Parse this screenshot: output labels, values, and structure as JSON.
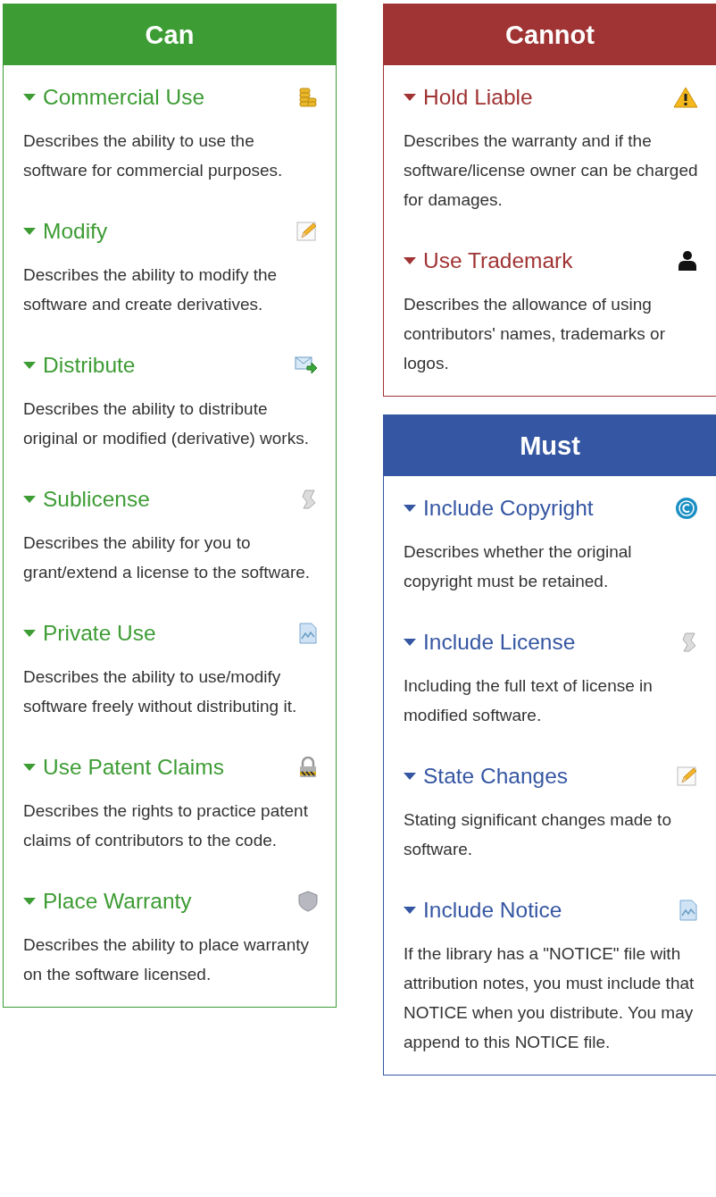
{
  "columns": [
    {
      "panels": [
        {
          "kind": "can",
          "title": "Can",
          "items": [
            {
              "title": "Commercial Use",
              "expanded": true,
              "description": "Describes the ability to use the software for commercial purposes."
            },
            {
              "title": "Modify",
              "expanded": true,
              "description": "Describes the ability to modify the software and create derivatives."
            },
            {
              "title": "Distribute",
              "expanded": true,
              "description": "Describes the ability to distribute original or modified (derivative) works."
            },
            {
              "title": "Sublicense",
              "expanded": true,
              "description": "Describes the ability for you to grant/extend a license to the software."
            },
            {
              "title": "Private Use",
              "expanded": true,
              "description": "Describes the ability to use/modify software freely without distributing it."
            },
            {
              "title": "Use Patent Claims",
              "expanded": true,
              "description": "Describes the rights to practice patent claims of contributors to the code."
            },
            {
              "title": "Place Warranty",
              "expanded": true,
              "description": "Describes the ability to place warranty on the software licensed."
            }
          ]
        }
      ]
    },
    {
      "panels": [
        {
          "kind": "cannot",
          "title": "Cannot",
          "items": [
            {
              "title": "Hold Liable",
              "expanded": true,
              "description": "Describes the warranty and if the software/license owner can be charged for damages."
            },
            {
              "title": "Use Trademark",
              "expanded": true,
              "description": "Describes the allowance of using contributors' names, trademarks or logos."
            }
          ]
        },
        {
          "kind": "must",
          "title": "Must",
          "items": [
            {
              "title": "Include Copyright",
              "expanded": true,
              "description": "Describes whether the original copyright must be retained."
            },
            {
              "title": "Include License",
              "expanded": true,
              "description": "Including the full text of license in modified software."
            },
            {
              "title": "State Changes",
              "expanded": true,
              "description": "Stating significant changes made to software."
            },
            {
              "title": "Include Notice",
              "expanded": true,
              "description": "If the library has a \"NOTICE\" file with attribution notes, you must include that NOTICE when you distribute. You may append to this NOTICE file."
            }
          ]
        }
      ]
    }
  ]
}
